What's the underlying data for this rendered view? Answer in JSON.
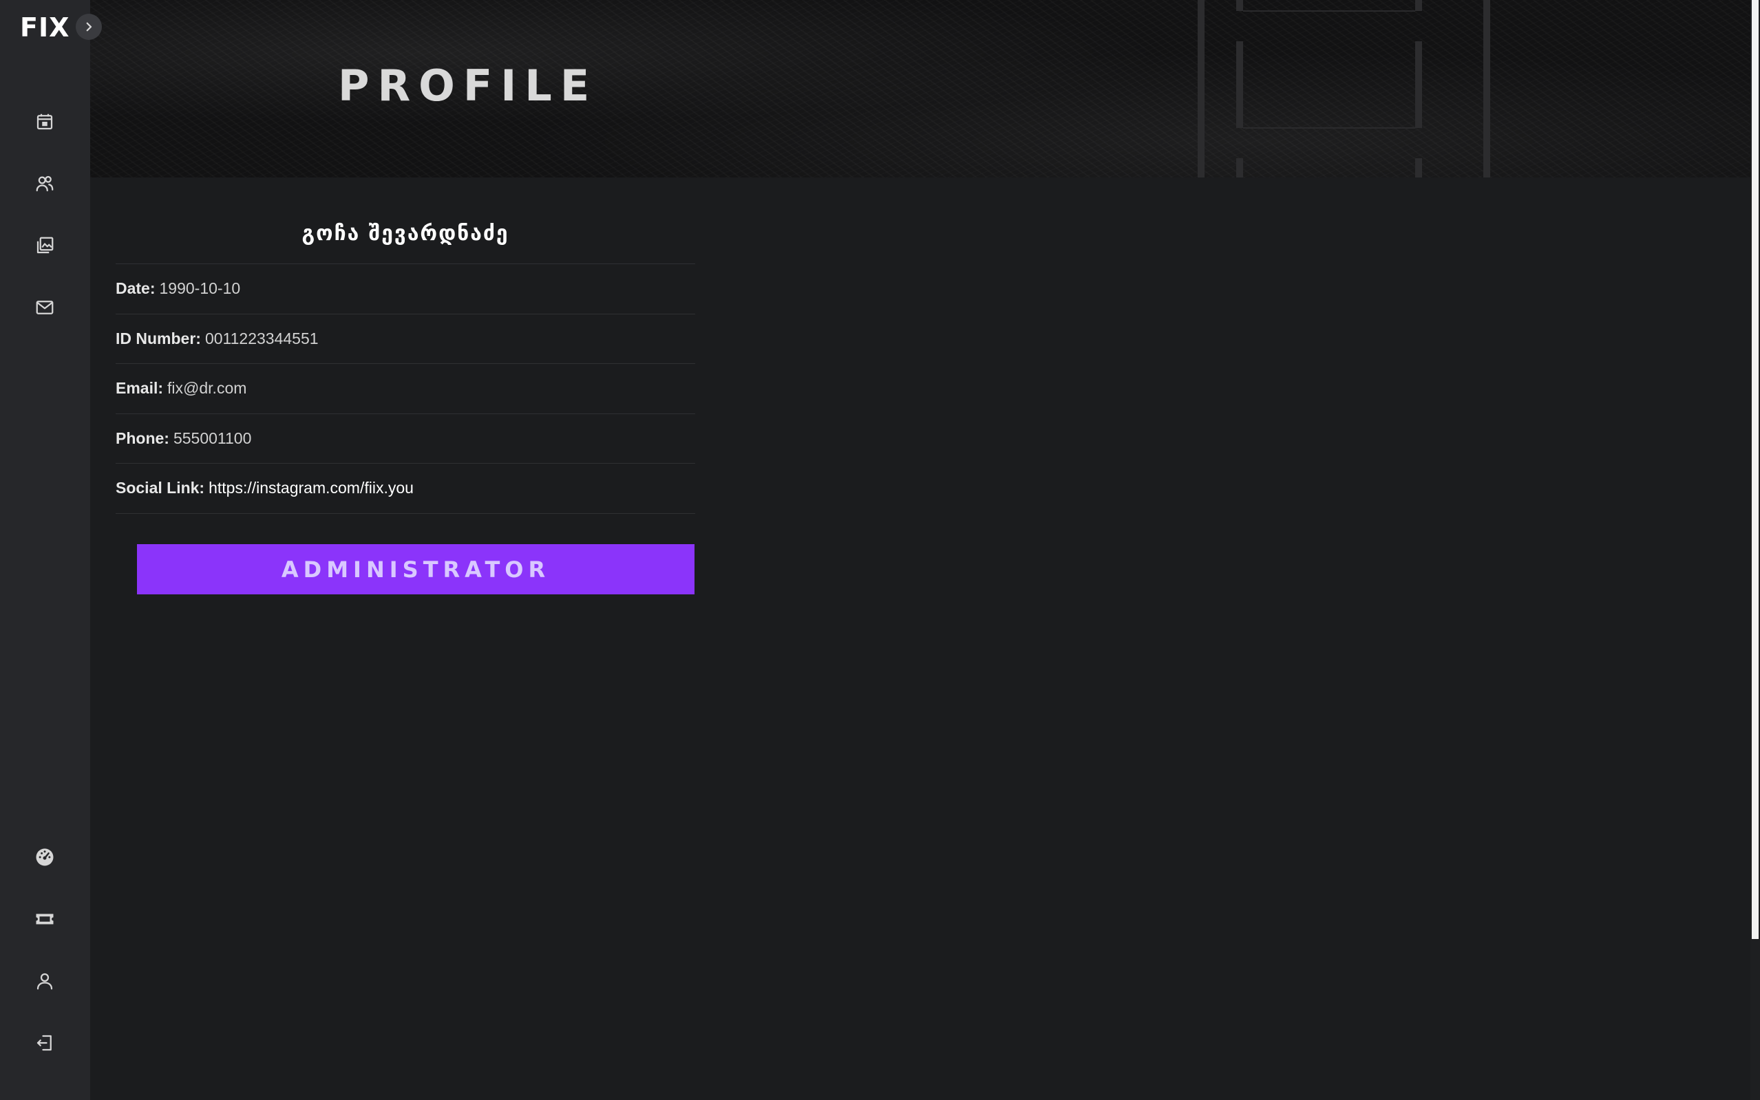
{
  "app": {
    "logo_text": "FIX",
    "sidebar": {
      "top_items": [
        {
          "icon": "calendar-icon"
        },
        {
          "icon": "users-icon"
        },
        {
          "icon": "gallery-icon"
        },
        {
          "icon": "mail-icon"
        }
      ],
      "bottom_items": [
        {
          "icon": "dashboard-icon"
        },
        {
          "icon": "ticket-icon"
        },
        {
          "icon": "user-icon"
        },
        {
          "icon": "logout-icon"
        }
      ]
    }
  },
  "header": {
    "title": "PROFILE"
  },
  "profile": {
    "name": "გოჩა შევარდნაძე",
    "fields": [
      {
        "label": "Date:",
        "value": "1990-10-10"
      },
      {
        "label": "ID Number:",
        "value": "0011223344551"
      },
      {
        "label": "Email:",
        "value": "fix@dr.com"
      },
      {
        "label": "Phone:",
        "value": "555001100"
      },
      {
        "label": "Social Link:",
        "value": "https://instagram.com/fiix.you"
      }
    ],
    "role_label": "ADMINISTRATOR"
  },
  "colors": {
    "accent": "#8b34fa",
    "sidebar_bg": "#26272a",
    "page_bg": "#1b1c1e"
  }
}
